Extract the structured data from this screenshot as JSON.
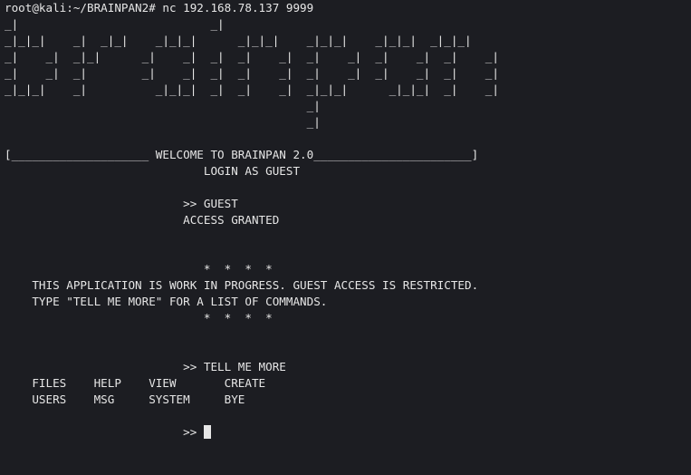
{
  "terminal": {
    "command": "root@kali:~/BRAINPAN2# nc 192.168.78.137 9999",
    "banner": [
      "_|                            _|",
      "_|_|_|    _|  _|_|    _|_|_|      _|_|_|    _|_|_|    _|_|_|  _|_|_|",
      "_|    _|  _|_|      _|    _|  _|  _|    _|  _|    _|  _|    _|  _|    _|",
      "_|    _|  _|        _|    _|  _|  _|    _|  _|    _|  _|    _|  _|    _|",
      "_|_|_|    _|          _|_|_|  _|  _|    _|  _|_|_|      _|_|_|  _|    _|",
      "                                            _|",
      "                                            _|"
    ],
    "welcome": "[____________________ WELCOME TO BRAINPAN 2.0_______________________]",
    "login_prompt": "                             LOGIN AS GUEST",
    "guest_input": "                          >> GUEST",
    "access": "                          ACCESS GRANTED",
    "stars_top": "                             *  *  *  *",
    "notice_1": "    THIS APPLICATION IS WORK IN PROGRESS. GUEST ACCESS IS RESTRICTED.",
    "notice_2": "    TYPE \"TELL ME MORE\" FOR A LIST OF COMMANDS.",
    "stars_bottom": "                             *  *  *  *",
    "tell_input": "                          >> TELL ME MORE",
    "commands_1": "    FILES    HELP    VIEW       CREATE",
    "commands_2": "    USERS    MSG     SYSTEM     BYE",
    "prompt": "                          >> "
  }
}
